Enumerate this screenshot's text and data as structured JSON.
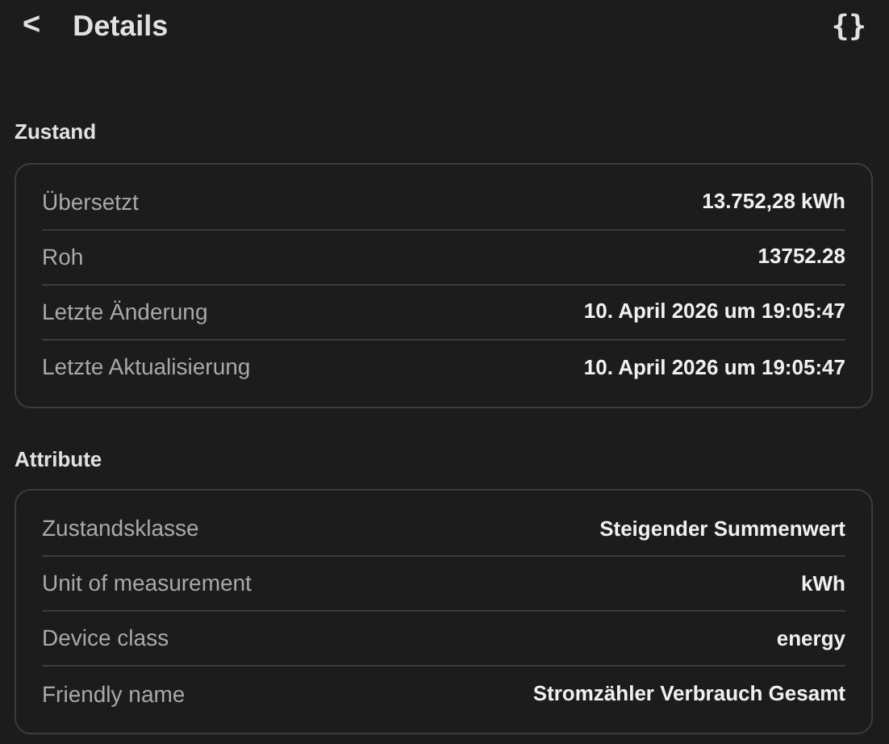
{
  "header": {
    "back": "<",
    "title": "Details",
    "code": "{}"
  },
  "sections": [
    {
      "title": "Zustand",
      "rows": [
        {
          "label": "Übersetzt",
          "value": "13.752,28 kWh"
        },
        {
          "label": "Roh",
          "value": "13752.28"
        },
        {
          "label": "Letzte Änderung",
          "value": "10. April 2026 um 19:05:47"
        },
        {
          "label": "Letzte Aktualisierung",
          "value": "10. April 2026 um 19:05:47"
        }
      ]
    },
    {
      "title": "Attribute",
      "rows": [
        {
          "label": "Zustandsklasse",
          "value": "Steigender Summenwert"
        },
        {
          "label": "Unit of measurement",
          "value": "kWh"
        },
        {
          "label": "Device class",
          "value": "energy"
        },
        {
          "label": "Friendly name",
          "value": "Stromzähler Verbrauch Gesamt"
        }
      ]
    }
  ]
}
